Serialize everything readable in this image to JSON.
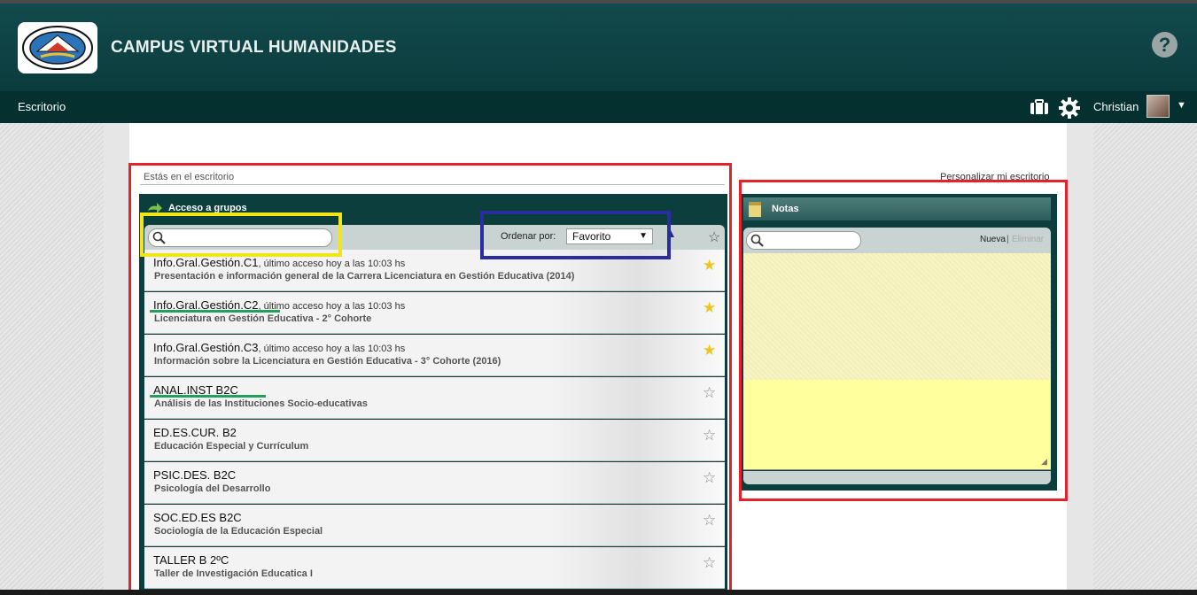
{
  "header": {
    "site_title": "CAMPUS VIRTUAL HUMANIDADES",
    "logo_text": "UNIVERSIDAD NACIONAL DE CATAMARCA",
    "help_label": "?"
  },
  "nav": {
    "desk_label": "Escritorio",
    "user_name": "Christian",
    "user_caret": "▼"
  },
  "page": {
    "breadcrumb": "Estás en el escritorio",
    "customize_link": "Personalizar mi escritorio"
  },
  "groups": {
    "title": "Acceso a grupos",
    "search_placeholder": "",
    "order_label": "Ordenar por:",
    "order_value": "Favorito",
    "items": [
      {
        "name": "Info.Gral.Gestión.C1",
        "access": ", último acceso hoy a las 10:03 hs",
        "desc": "Presentación e información general de la Carrera Licenciatura en Gestión Educativa (2014)",
        "favorite": true
      },
      {
        "name": "Info.Gral.Gestión.C2",
        "access": ", último acceso hoy a las 10:03 hs",
        "desc": "Licenciatura en Gestión Educativa - 2° Cohorte",
        "favorite": true
      },
      {
        "name": "Info.Gral.Gestión.C3",
        "access": ", último acceso hoy a las 10:03 hs",
        "desc": "Información sobre la Licenciatura en Gestión Educativa - 3° Cohorte (2016)",
        "favorite": true
      },
      {
        "name": "ANAL.INST B2C",
        "access": "",
        "desc": "Análisis de las Instituciones Socio-educativas",
        "favorite": false
      },
      {
        "name": "ED.ES.CUR. B2",
        "access": "",
        "desc": "Educación Especial y Currículum",
        "favorite": false
      },
      {
        "name": "PSIC.DES. B2C",
        "access": "",
        "desc": "Psicología del Desarrollo",
        "favorite": false
      },
      {
        "name": "SOC.ED.ES B2C",
        "access": "",
        "desc": "Sociología de la Educación Especial",
        "favorite": false
      },
      {
        "name": "TALLER B 2ºC",
        "access": "",
        "desc": "Taller de Investigación Educatica I",
        "favorite": false
      }
    ]
  },
  "notes": {
    "title": "Notas",
    "search_placeholder": "",
    "new_label": "Nueva",
    "separator": "|",
    "delete_label": "Eliminar",
    "text": ""
  },
  "colors": {
    "header_bg": "#0b3c3d",
    "highlight_red": "#e3222b",
    "highlight_yellow": "#f1e515",
    "highlight_blue": "#2a2d9c",
    "underline_green": "#22a05a",
    "favorite_star": "#f0c419"
  }
}
